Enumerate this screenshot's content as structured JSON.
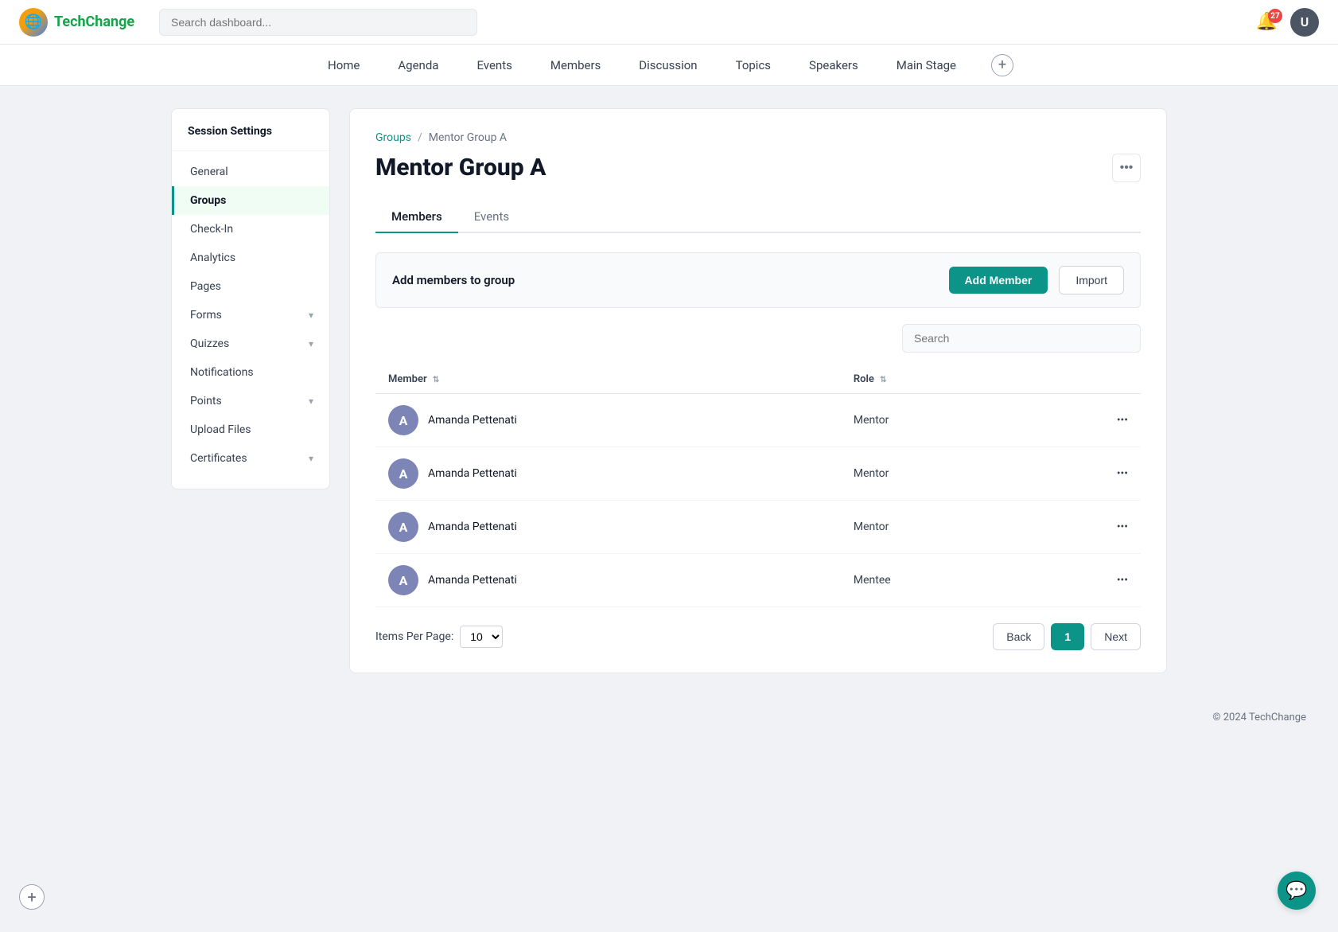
{
  "logo": {
    "icon": "🌐",
    "text_part1": "Tech",
    "text_part2": "Change"
  },
  "header": {
    "search_placeholder": "Search dashboard...",
    "notification_count": "27",
    "avatar_initial": "U"
  },
  "nav": {
    "items": [
      {
        "label": "Home",
        "id": "home"
      },
      {
        "label": "Agenda",
        "id": "agenda"
      },
      {
        "label": "Events",
        "id": "events"
      },
      {
        "label": "Members",
        "id": "members"
      },
      {
        "label": "Discussion",
        "id": "discussion"
      },
      {
        "label": "Topics",
        "id": "topics"
      },
      {
        "label": "Speakers",
        "id": "speakers"
      },
      {
        "label": "Main Stage",
        "id": "main-stage"
      }
    ],
    "add_label": "+"
  },
  "sidebar": {
    "title": "Session Settings",
    "items": [
      {
        "label": "General",
        "id": "general",
        "active": false,
        "has_chevron": false
      },
      {
        "label": "Groups",
        "id": "groups",
        "active": true,
        "has_chevron": false
      },
      {
        "label": "Check-In",
        "id": "check-in",
        "active": false,
        "has_chevron": false
      },
      {
        "label": "Analytics",
        "id": "analytics",
        "active": false,
        "has_chevron": false
      },
      {
        "label": "Pages",
        "id": "pages",
        "active": false,
        "has_chevron": false
      },
      {
        "label": "Forms",
        "id": "forms",
        "active": false,
        "has_chevron": true
      },
      {
        "label": "Quizzes",
        "id": "quizzes",
        "active": false,
        "has_chevron": true
      },
      {
        "label": "Notifications",
        "id": "notifications",
        "active": false,
        "has_chevron": false
      },
      {
        "label": "Points",
        "id": "points",
        "active": false,
        "has_chevron": true
      },
      {
        "label": "Upload Files",
        "id": "upload-files",
        "active": false,
        "has_chevron": false
      },
      {
        "label": "Certificates",
        "id": "certificates",
        "active": false,
        "has_chevron": true
      }
    ]
  },
  "content": {
    "breadcrumb_link": "Groups",
    "breadcrumb_sep": "/",
    "breadcrumb_current": "Mentor Group A",
    "page_title": "Mentor Group A",
    "tabs": [
      {
        "label": "Members",
        "active": true
      },
      {
        "label": "Events",
        "active": false
      }
    ],
    "add_members_label": "Add members to group",
    "add_member_btn": "Add Member",
    "import_btn": "Import",
    "search_placeholder": "Search",
    "table": {
      "col_member": "Member",
      "col_role": "Role",
      "rows": [
        {
          "initial": "A",
          "name": "Amanda Pettenati",
          "role": "Mentor"
        },
        {
          "initial": "A",
          "name": "Amanda Pettenati",
          "role": "Mentor"
        },
        {
          "initial": "A",
          "name": "Amanda Pettenati",
          "role": "Mentor"
        },
        {
          "initial": "A",
          "name": "Amanda Pettenati",
          "role": "Mentee"
        }
      ]
    },
    "pagination": {
      "items_per_page_label": "Items Per Page:",
      "items_per_page_value": "10",
      "back_btn": "Back",
      "next_btn": "Next",
      "current_page": "1"
    }
  },
  "footer": {
    "copyright": "© 2024 TechChange"
  }
}
